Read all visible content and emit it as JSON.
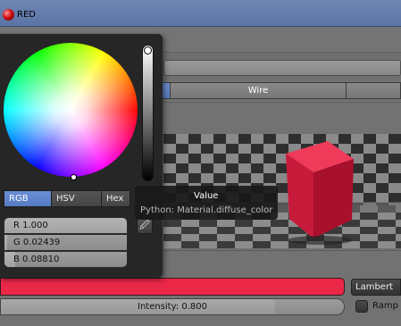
{
  "header": {
    "title": "RED"
  },
  "type_tabs": [
    {
      "label": "",
      "active": true
    },
    {
      "label": "Wire",
      "active": false
    },
    {
      "label": "",
      "active": false
    }
  ],
  "color_picker": {
    "modes": [
      {
        "label": "RGB",
        "active": true
      },
      {
        "label": "HSV",
        "active": false
      },
      {
        "label": "Hex",
        "active": false
      }
    ],
    "fields": [
      {
        "text": "R 1.000",
        "value": 1.0
      },
      {
        "text": "G 0.02439",
        "value": 0.02439
      },
      {
        "text": "B 0.08810",
        "value": 0.0881
      }
    ],
    "eyedropper_icon": "eyedropper-icon"
  },
  "tooltip": {
    "title": "Value",
    "python": "Python: Material.diffuse_color"
  },
  "diffuse": {
    "color": "#ea2747",
    "shader": "Lambert",
    "intensity_text": "Intensity: 0.800",
    "intensity_value": 0.8,
    "ramp_label": "Ramp"
  },
  "colors": {
    "header": "#5a74a6",
    "accent": "#5a7bbd",
    "material_red": "#ea2747"
  }
}
